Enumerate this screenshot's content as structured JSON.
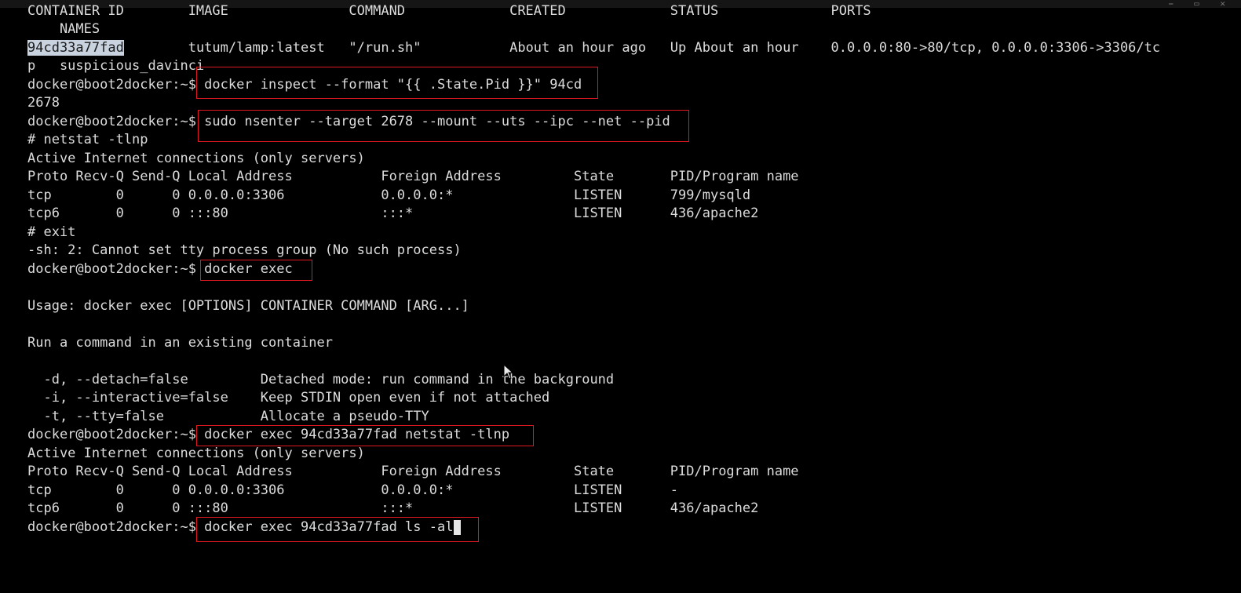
{
  "terminal": {
    "lines": [
      "CONTAINER ID        IMAGE               COMMAND             CREATED             STATUS              PORTS",
      "    NAMES",
      "",
      "p   suspicious_davinci",
      "docker@boot2docker:~$ docker inspect --format \"{{ .State.Pid }}\" 94cd",
      "2678",
      "docker@boot2docker:~$ sudo nsenter --target 2678 --mount --uts --ipc --net --pid",
      "# netstat -tlnp",
      "Active Internet connections (only servers)",
      "Proto Recv-Q Send-Q Local Address           Foreign Address         State       PID/Program name",
      "tcp        0      0 0.0.0.0:3306            0.0.0.0:*               LISTEN      799/mysqld",
      "tcp6       0      0 :::80                   :::*                    LISTEN      436/apache2",
      "# exit",
      "-sh: 2: Cannot set tty process group (No such process)",
      "docker@boot2docker:~$ docker exec",
      "",
      "Usage: docker exec [OPTIONS] CONTAINER COMMAND [ARG...]",
      "",
      "Run a command in an existing container",
      "",
      "  -d, --detach=false         Detached mode: run command in the background",
      "  -i, --interactive=false    Keep STDIN open even if not attached",
      "  -t, --tty=false            Allocate a pseudo-TTY",
      "docker@boot2docker:~$ docker exec 94cd33a77fad netstat -tlnp",
      "Active Internet connections (only servers)",
      "Proto Recv-Q Send-Q Local Address           Foreign Address         State       PID/Program name",
      "tcp        0      0 0.0.0.0:3306            0.0.0.0:*               LISTEN      -",
      "tcp6       0      0 :::80                   :::*                    LISTEN      436/apache2",
      "docker@boot2docker:~$ docker exec 94cd33a77fad ls -al"
    ],
    "container_row": {
      "id_selected": "94cd33a77fad",
      "rest": "        tutum/lamp:latest   \"/run.sh\"           About an hour ago   Up About an hour    0.0.0.0:80->80/tcp, 0.0.0.0:3306->3306/tc"
    },
    "highlight_color": "#e0181f",
    "selection_color": "#c9d3e0"
  }
}
